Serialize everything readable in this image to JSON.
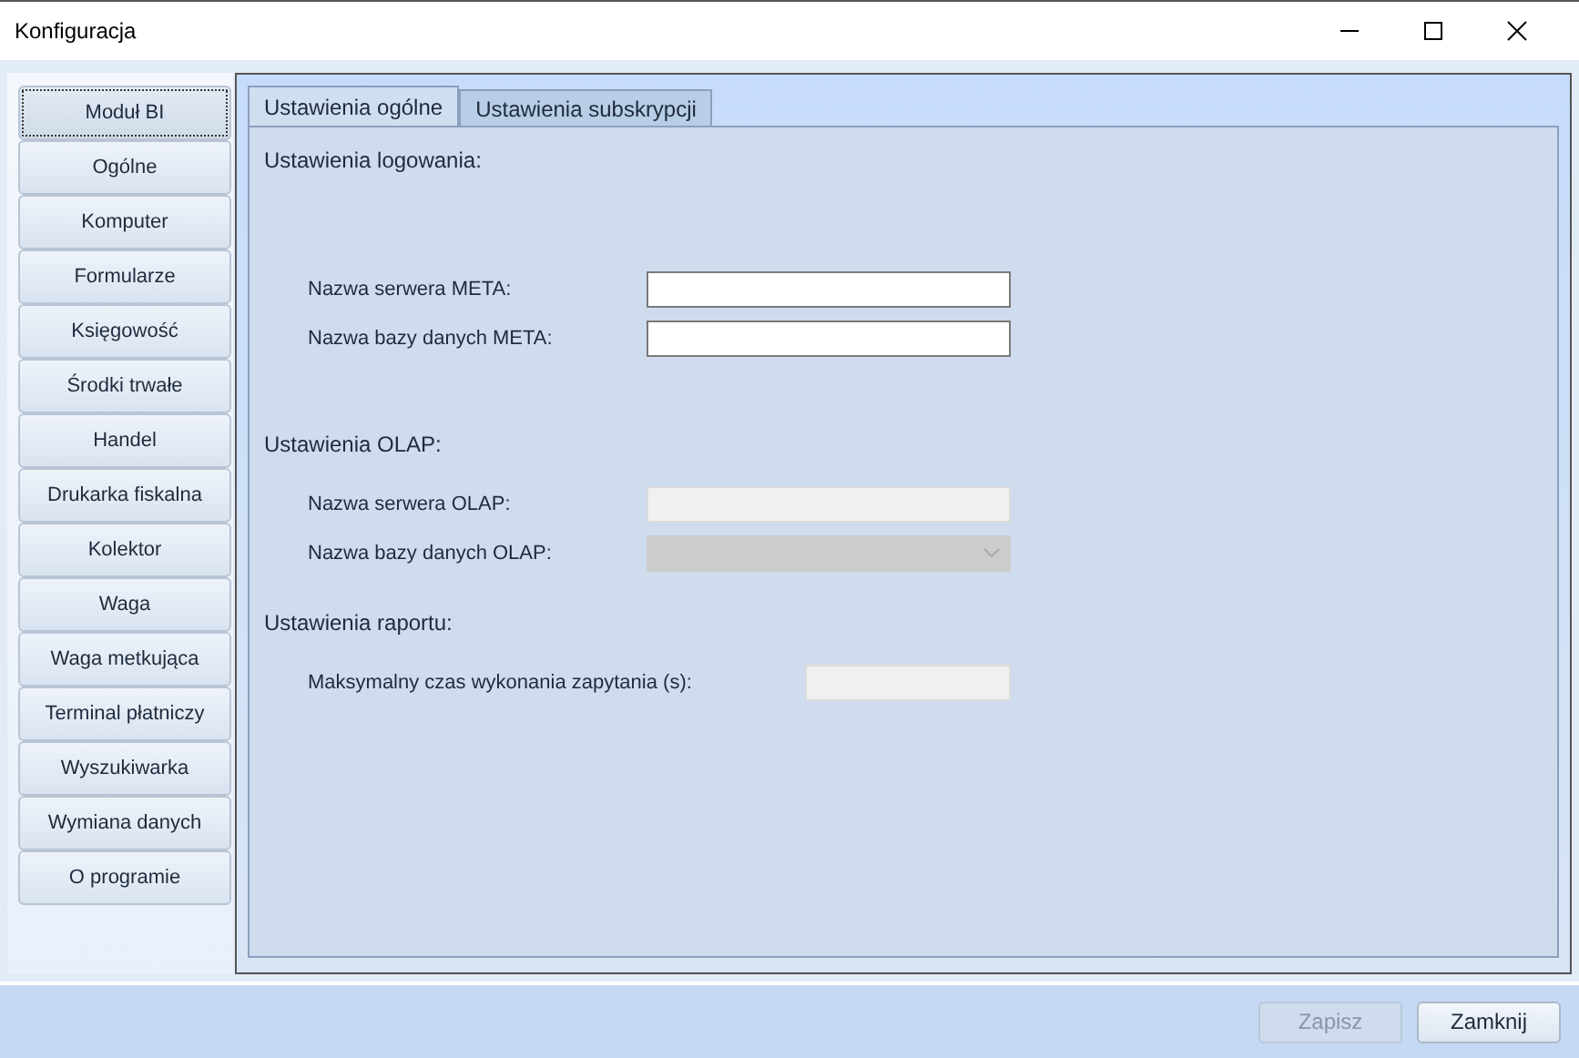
{
  "window": {
    "title": "Konfiguracja"
  },
  "sidebar": {
    "items": [
      {
        "label": "Moduł BI",
        "selected": true
      },
      {
        "label": "Ogólne",
        "selected": false
      },
      {
        "label": "Komputer",
        "selected": false
      },
      {
        "label": "Formularze",
        "selected": false
      },
      {
        "label": "Księgowość",
        "selected": false
      },
      {
        "label": "Środki trwałe",
        "selected": false
      },
      {
        "label": "Handel",
        "selected": false
      },
      {
        "label": "Drukarka fiskalna",
        "selected": false
      },
      {
        "label": "Kolektor",
        "selected": false
      },
      {
        "label": "Waga",
        "selected": false
      },
      {
        "label": "Waga metkująca",
        "selected": false
      },
      {
        "label": "Terminal płatniczy",
        "selected": false
      },
      {
        "label": "Wyszukiwarka",
        "selected": false
      },
      {
        "label": "Wymiana danych",
        "selected": false
      },
      {
        "label": "O programie",
        "selected": false
      }
    ]
  },
  "tabs": [
    {
      "label": "Ustawienia ogólne",
      "selected": true
    },
    {
      "label": "Ustawienia subskrypcji",
      "selected": false
    }
  ],
  "sections": [
    {
      "title": "Ustawienia logowania:",
      "fields": [
        {
          "label": "Nazwa serwera META:",
          "kind": "text",
          "disabled": false
        },
        {
          "label": "Nazwa bazy danych META:",
          "kind": "text",
          "disabled": false
        }
      ]
    },
    {
      "title": "Ustawienia OLAP:",
      "fields": [
        {
          "label": "Nazwa serwera OLAP:",
          "kind": "text",
          "disabled": true
        },
        {
          "label": "Nazwa bazy danych OLAP:",
          "kind": "combo",
          "disabled": true
        }
      ]
    },
    {
      "title": "Ustawienia raportu:",
      "fields": [
        {
          "label": "Maksymalny czas wykonania zapytania (s):",
          "kind": "short",
          "disabled": true
        }
      ]
    }
  ],
  "buttons": [
    {
      "label": "Zapisz",
      "disabled": true
    },
    {
      "label": "Zamknij",
      "disabled": false
    }
  ]
}
